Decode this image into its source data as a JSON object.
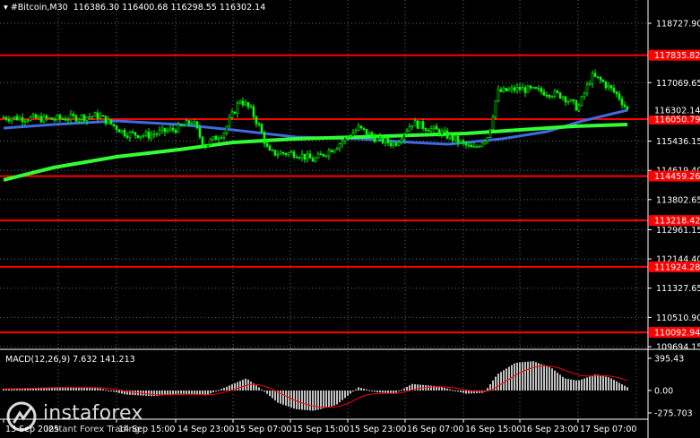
{
  "header": {
    "symbol": "#Bitcoin,M30",
    "ohlc": "116386.30 116400.68 116298.55 116302.14"
  },
  "price_axis": {
    "ticks": [
      "118727.90",
      "117069.65",
      "115436.15",
      "114619.40",
      "113802.65",
      "112961.15",
      "112144.40",
      "111327.65",
      "110510.90",
      "109694.15"
    ]
  },
  "levels": [
    {
      "price": 117835.82,
      "label": "117835.82"
    },
    {
      "price": 116050.79,
      "label": "116050.79"
    },
    {
      "price": 114459.26,
      "label": "114459.26"
    },
    {
      "price": 113218.42,
      "label": "113218.42"
    },
    {
      "price": 111924.28,
      "label": "111924.28"
    },
    {
      "price": 110092.94,
      "label": "110092.94"
    }
  ],
  "current_price": {
    "price": 116302.14,
    "label": "116302.14"
  },
  "macd": {
    "label": "MACD(12,26,9) 7.632 141.213",
    "ticks": [
      "395.43",
      "0.00",
      "-275.703"
    ]
  },
  "time_axis": {
    "labels": [
      "13 Sep 2025",
      "14 Sep 15:00",
      "14 Sep 23:00",
      "15 Sep 07:00",
      "15 Sep 15:00",
      "15 Sep 23:00",
      "16 Sep 07:00",
      "16 Sep 15:00",
      "16 Sep 23:00",
      "17 Sep 07:00"
    ]
  },
  "logo": {
    "name": "instaforex",
    "tagline": "Instant Forex Trading"
  },
  "colors": {
    "background": "#000000",
    "level_line": "#ff0000",
    "level_label_bg": "#ff0000",
    "candle_up": "#00ff00",
    "candle_down": "#00ff00",
    "ma_fast": "#4169e1",
    "ma_slow": "#32ff32",
    "macd_hist": "#c0c0c0",
    "macd_signal": "#ff0000",
    "grid": "#c0c0c0"
  }
}
